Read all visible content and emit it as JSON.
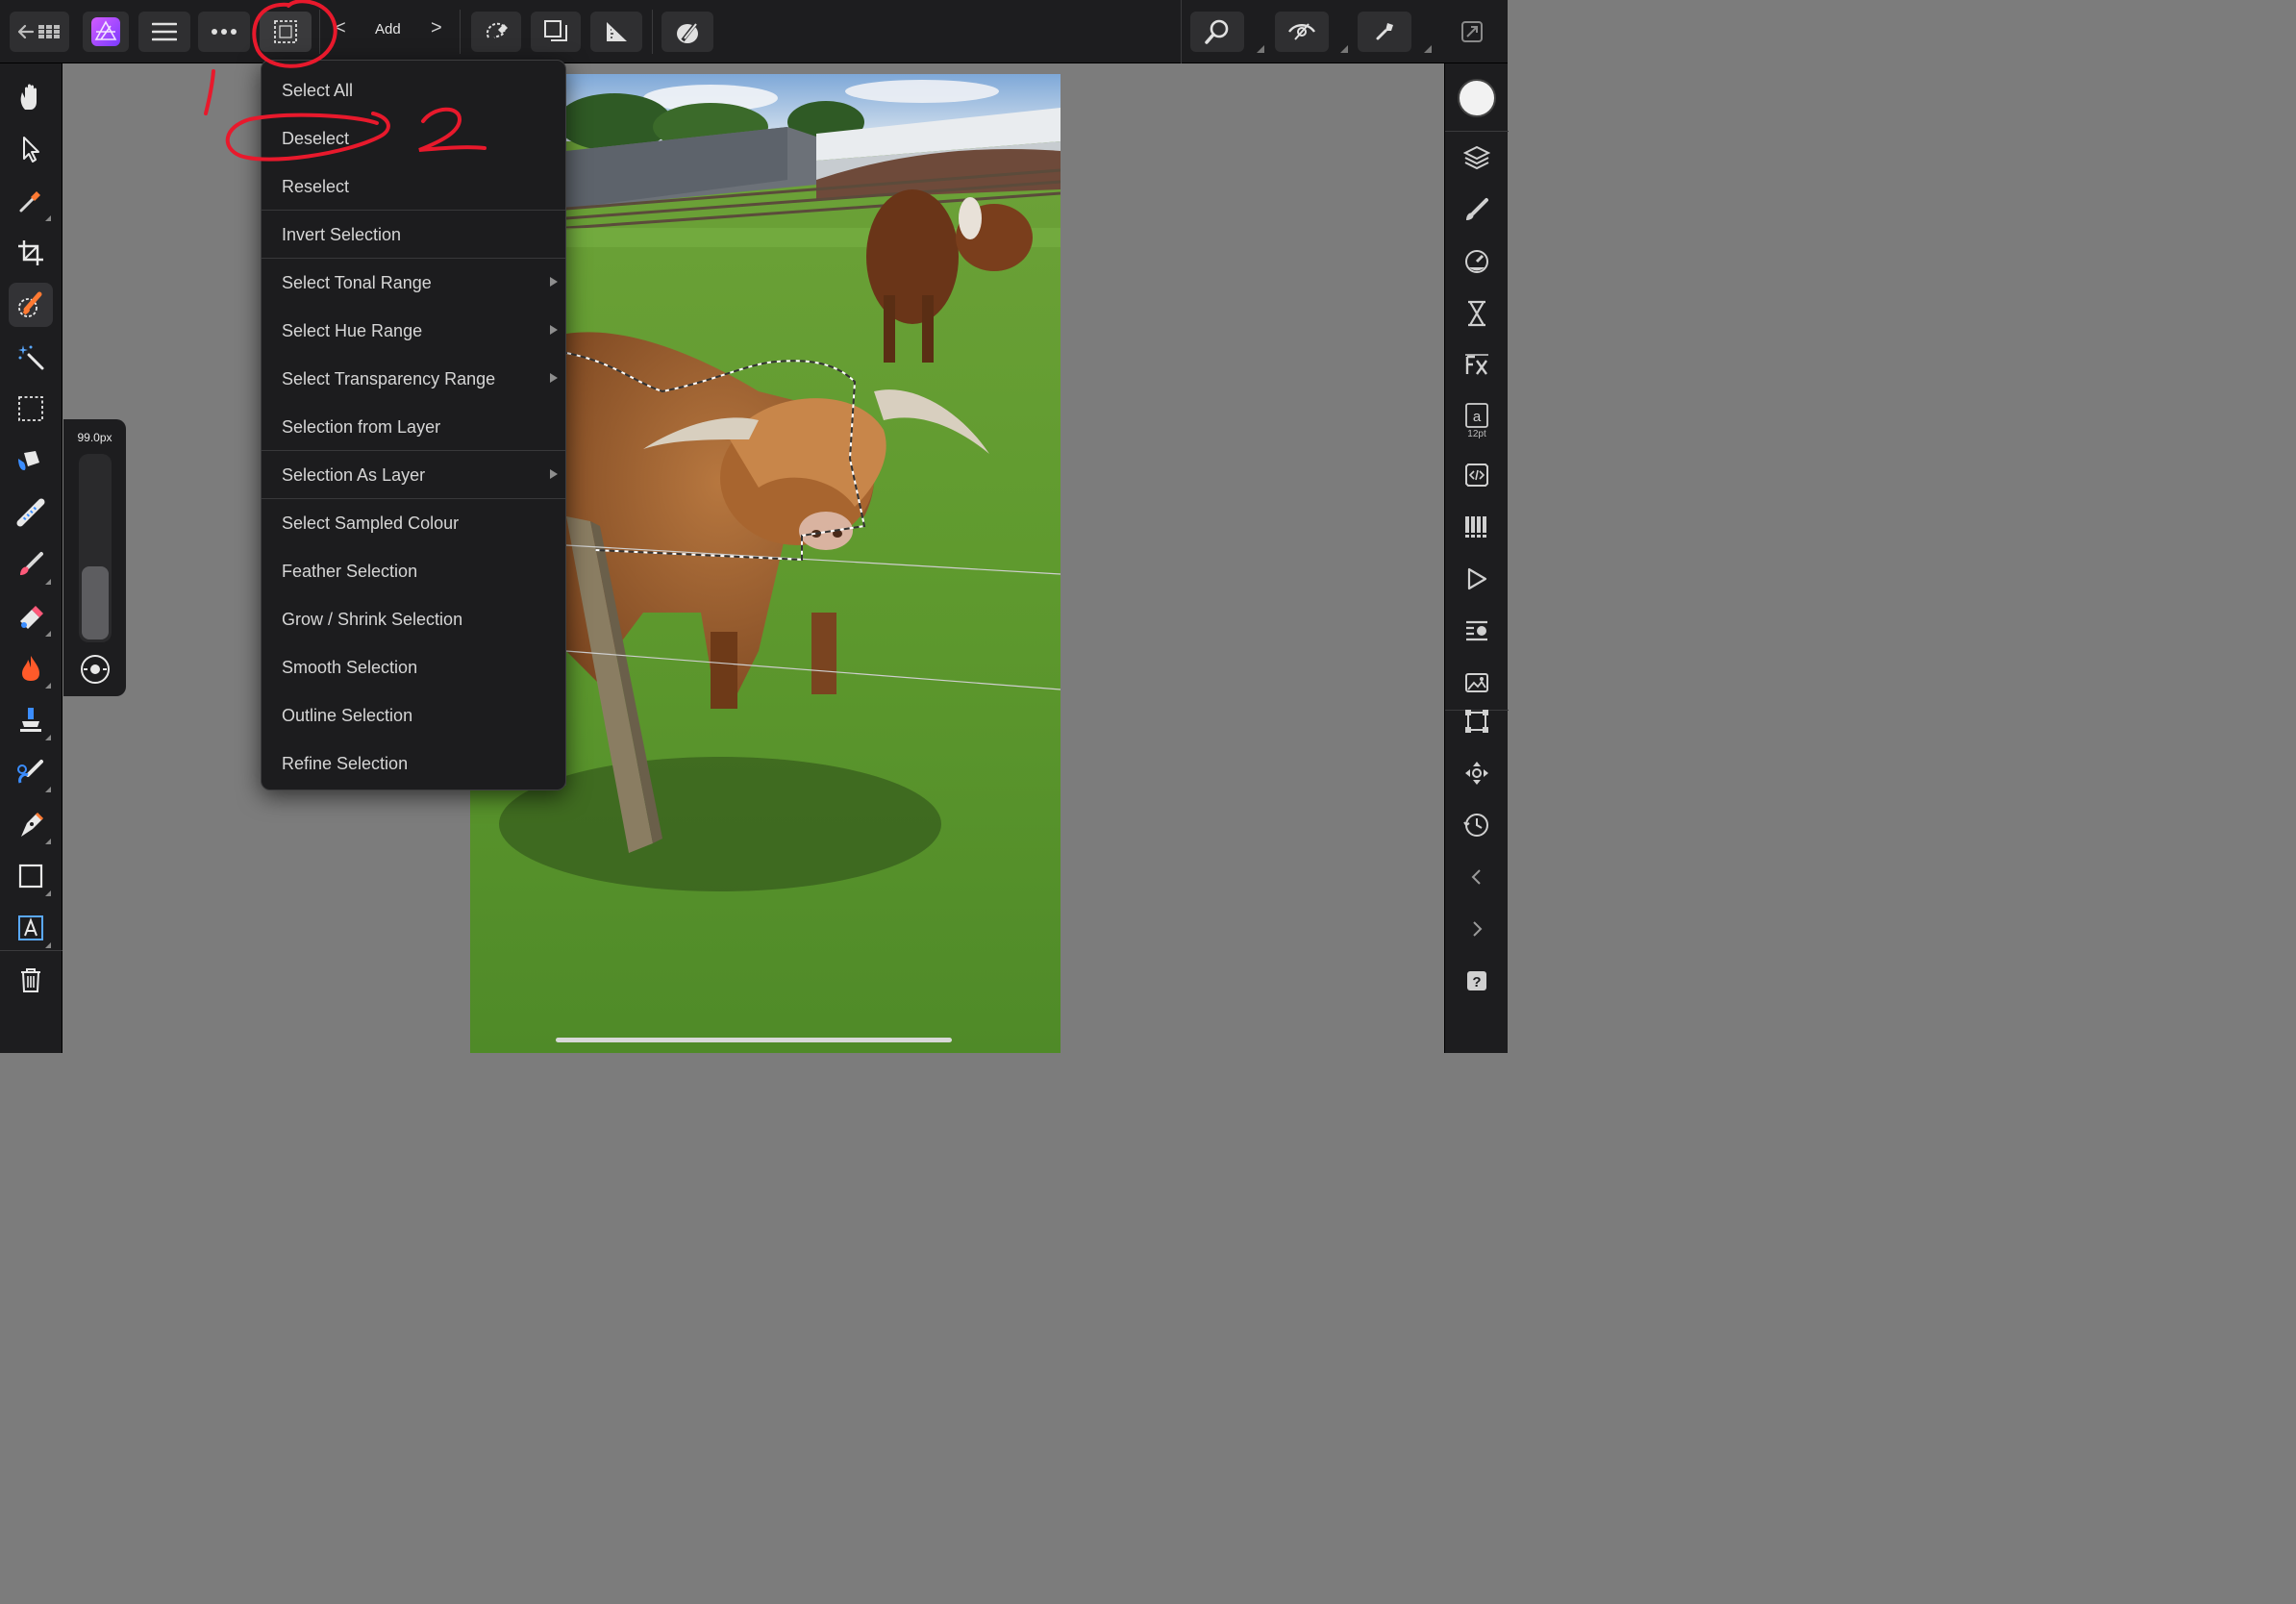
{
  "toolbar": {
    "mode_label": "Add",
    "prev_mode": "<",
    "next_mode": ">",
    "buttons": [
      "back-grid-icon",
      "affinity-photo-logo",
      "hamburger-menu-icon",
      "more-dots-icon",
      "selection-marquee-icon",
      "magnetic-lasso-icon",
      "layers-stack-icon",
      "ruler-corner-icon",
      "erase-brush-icon",
      "search-zoom-icon",
      "view-eye-icon",
      "assistant-icon",
      "window-toggle-icon"
    ]
  },
  "left_tools": [
    "hand-icon",
    "move-arrow-icon",
    "color-picker-icon",
    "crop-icon",
    "selection-brush-icon",
    "magic-wand-icon",
    "rectangular-marquee-icon",
    "flood-fill-icon",
    "gradient-icon",
    "paint-brush-icon",
    "erase-icon",
    "dodge-burn-icon",
    "clone-stamp-icon",
    "retouch-brush-icon",
    "pen-icon",
    "rectangle-shape-icon",
    "artistic-text-icon",
    "trash-icon"
  ],
  "size_slider": {
    "label": "99.0px",
    "fill": 0.4
  },
  "right_studio": [
    "color-well",
    "layers-icon",
    "brushes-icon",
    "adjustments-icon",
    "hourglass-icon",
    "fx-icon",
    "text-style-icon",
    "code-icon",
    "swatches-icon",
    "play-icon",
    "properties-icon",
    "image-icon",
    "transform-icon",
    "move-anchor-icon",
    "history-icon",
    "chevron-left-icon",
    "chevron-right-icon",
    "help-icon"
  ],
  "text_style_size": "12pt",
  "menu": {
    "items": [
      {
        "label": "Select All",
        "submenu": false
      },
      {
        "label": "Deselect",
        "submenu": false
      },
      {
        "label": "Reselect",
        "submenu": false
      },
      {
        "label": "Invert Selection",
        "submenu": false
      },
      {
        "label": "Select Tonal Range",
        "submenu": true
      },
      {
        "label": "Select Hue Range",
        "submenu": true
      },
      {
        "label": "Select Transparency Range",
        "submenu": true
      },
      {
        "label": "Selection from Layer",
        "submenu": false
      },
      {
        "label": "Selection As Layer",
        "submenu": true
      },
      {
        "label": "Select Sampled Colour",
        "submenu": false
      },
      {
        "label": "Feather Selection",
        "submenu": false
      },
      {
        "label": "Grow / Shrink Selection",
        "submenu": false
      },
      {
        "label": "Smooth Selection",
        "submenu": false
      },
      {
        "label": "Outline Selection",
        "submenu": false
      },
      {
        "label": "Refine Selection",
        "submenu": false
      }
    ]
  },
  "annotations": {
    "color": "#e8192c",
    "step1": "1",
    "step2": "2"
  },
  "colors": {
    "toolbar_bg": "#1d1d1f",
    "canvas_bg": "#7c7c7c",
    "menu_bg": "#1c1c1e",
    "accent": "#ff7a33"
  }
}
